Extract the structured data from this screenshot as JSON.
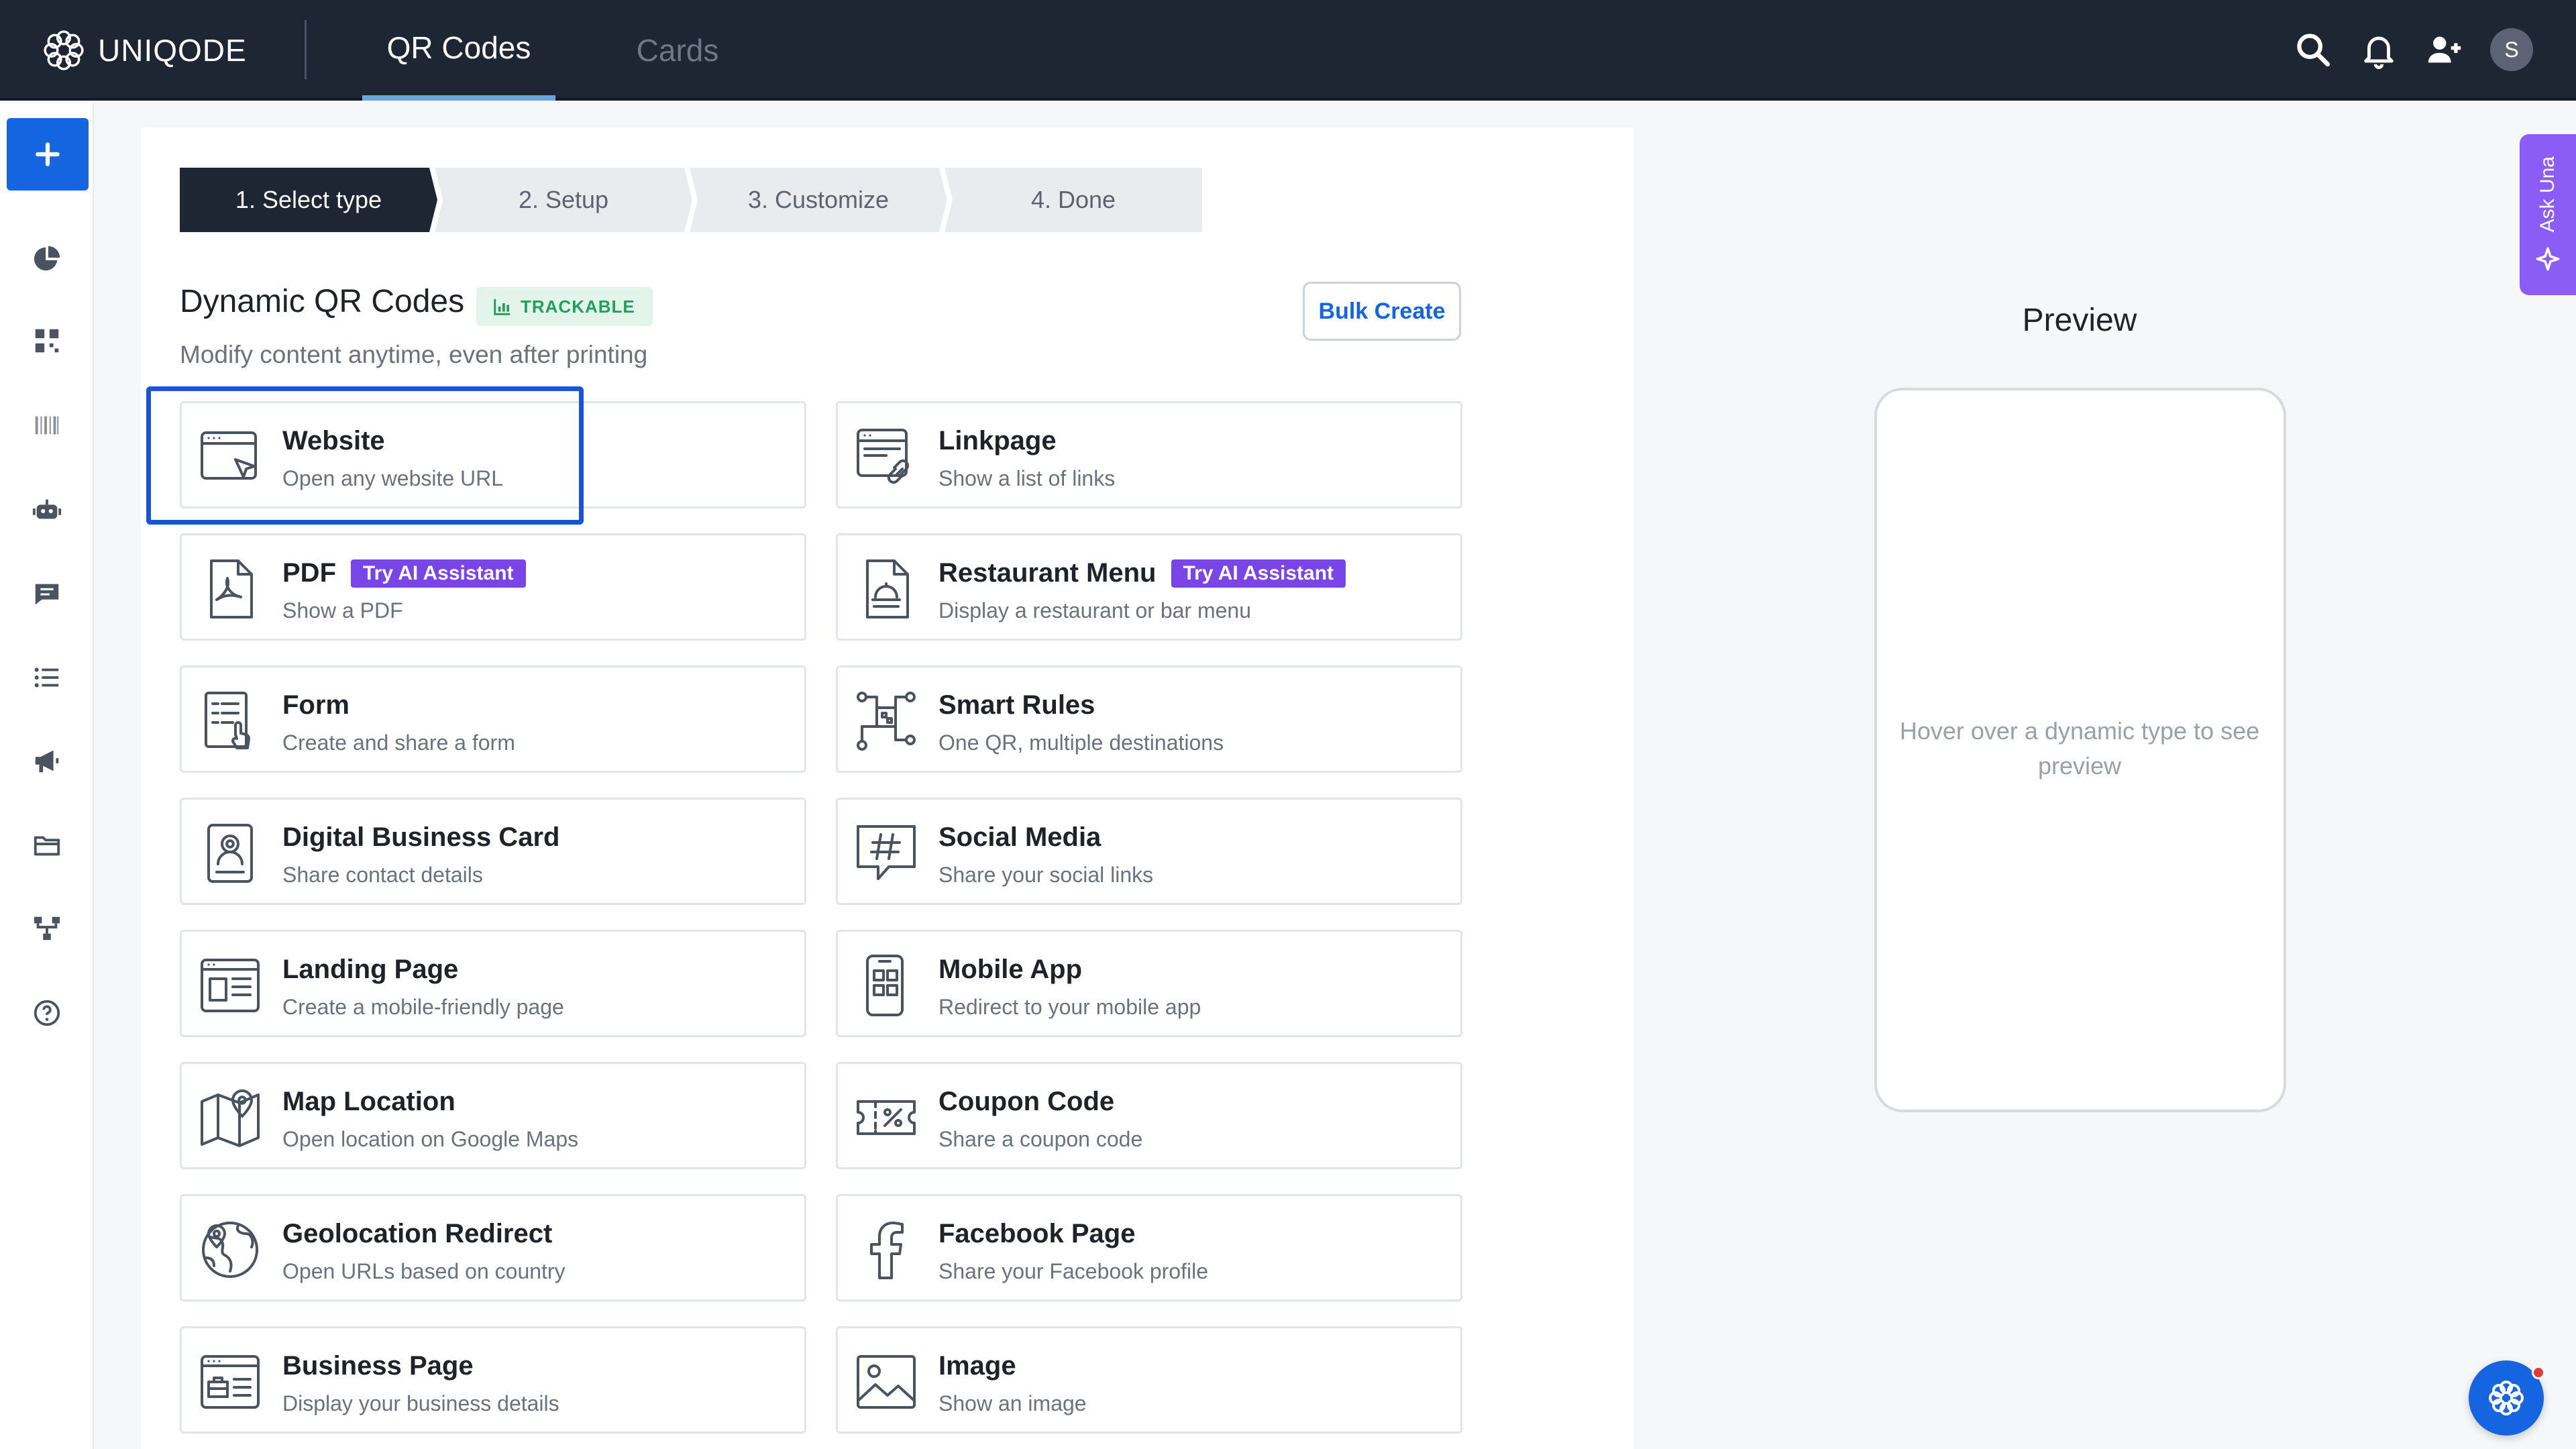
{
  "brand": {
    "name": "UNIQODE"
  },
  "nav": {
    "tabs": [
      {
        "label": "QR Codes"
      },
      {
        "label": "Cards"
      }
    ],
    "avatar_initial": "S"
  },
  "sidebar": {
    "icons": [
      "create-plus-icon",
      "analytics-pie-icon",
      "qr-grid-icon",
      "barcode-icon",
      "robot-icon",
      "chat-icon",
      "list-icon",
      "megaphone-icon",
      "folder-icon",
      "hierarchy-icon",
      "help-icon"
    ]
  },
  "stepper": {
    "steps": [
      {
        "label": "1. Select type"
      },
      {
        "label": "2. Setup"
      },
      {
        "label": "3. Customize"
      },
      {
        "label": "4. Done"
      }
    ]
  },
  "section": {
    "title": "Dynamic QR Codes",
    "badge": "TRACKABLE",
    "subtitle": "Modify content anytime, even after printing",
    "bulk_create": "Bulk Create"
  },
  "types": [
    {
      "title": "Website",
      "desc": "Open any website URL",
      "icon": "website-icon"
    },
    {
      "title": "Linkpage",
      "desc": "Show a list of links",
      "icon": "linkpage-icon"
    },
    {
      "title": "PDF",
      "desc": "Show a PDF",
      "badge": "Try AI Assistant",
      "icon": "pdf-icon"
    },
    {
      "title": "Restaurant Menu",
      "desc": "Display a restaurant or bar menu",
      "badge": "Try AI Assistant",
      "icon": "restaurant-menu-icon"
    },
    {
      "title": "Form",
      "desc": "Create and share a form",
      "icon": "form-icon"
    },
    {
      "title": "Smart Rules",
      "desc": "One QR, multiple destinations",
      "icon": "smart-rules-icon"
    },
    {
      "title": "Digital Business Card",
      "desc": "Share contact details",
      "icon": "business-card-icon"
    },
    {
      "title": "Social Media",
      "desc": "Share your social links",
      "icon": "social-media-icon"
    },
    {
      "title": "Landing Page",
      "desc": "Create a mobile-friendly page",
      "icon": "landing-page-icon"
    },
    {
      "title": "Mobile App",
      "desc": "Redirect to your mobile app",
      "icon": "mobile-app-icon"
    },
    {
      "title": "Map Location",
      "desc": "Open location on Google Maps",
      "icon": "map-location-icon"
    },
    {
      "title": "Coupon Code",
      "desc": "Share a coupon code",
      "icon": "coupon-icon"
    },
    {
      "title": "Geolocation Redirect",
      "desc": "Open URLs based on country",
      "icon": "geolocation-icon"
    },
    {
      "title": "Facebook Page",
      "desc": "Share your Facebook profile",
      "icon": "facebook-icon"
    },
    {
      "title": "Business Page",
      "desc": "Display your business details",
      "icon": "business-page-icon"
    },
    {
      "title": "Image",
      "desc": "Show an image",
      "icon": "image-icon"
    }
  ],
  "preview": {
    "title": "Preview",
    "hint": "Hover over a dynamic type to see preview"
  },
  "ask_una": {
    "label": "Ask Una"
  },
  "colors": {
    "topbar": "#1e2533",
    "primary": "#1565e0",
    "ai_badge": "#7a45e6",
    "trackable": "#22a05b",
    "ask_una": "#8b5cf6"
  }
}
